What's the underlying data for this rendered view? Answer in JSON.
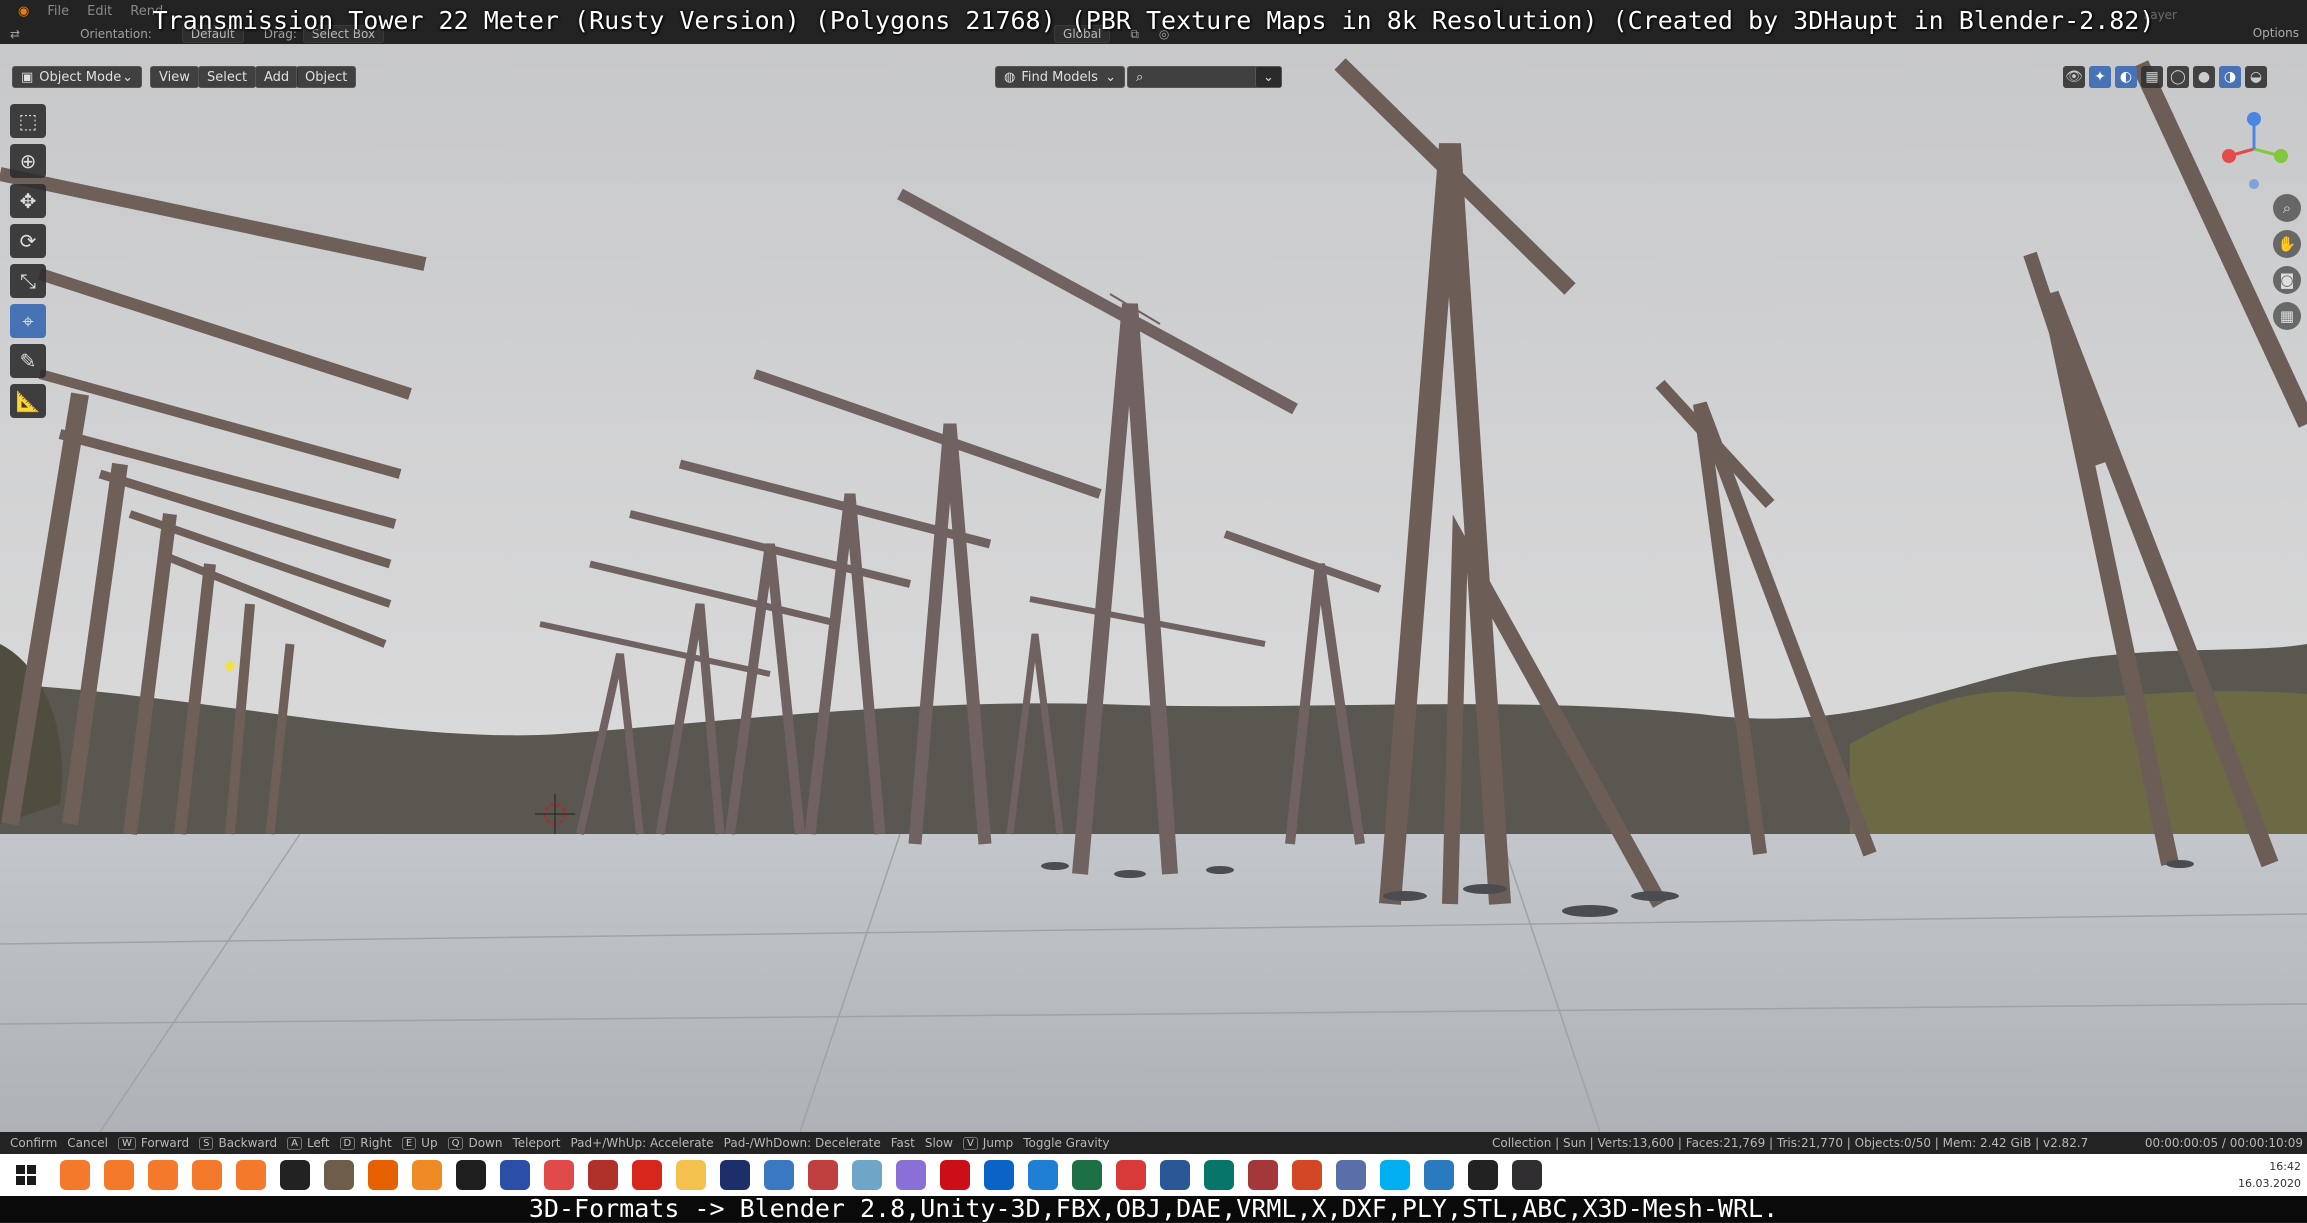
{
  "overlay": {
    "title": "Transmission Tower 22 Meter (Rusty Version) (Polygons 21768) (PBR Texture Maps in 8k Resolution) (Created by 3DHaupt in Blender-2.82)",
    "caption": "3D-Formats -> Blender 2.8,Unity-3D,FBX,OBJ,DAE,VRML,X,DXF,PLY,STL,ABC,X3D-Mesh-WRL."
  },
  "menu": {
    "items": [
      "File",
      "Edit",
      "Rend"
    ]
  },
  "header": {
    "orientation_label": "Orientation:",
    "orientation_value": "Default",
    "drag_label": "Drag:",
    "drag_value": "Select Box",
    "transform_value": "Global",
    "options_label": "Options",
    "layer_label": "Layer"
  },
  "viewport_header": {
    "mode": "Object Mode",
    "menus": [
      "View",
      "Select",
      "Add",
      "Object"
    ],
    "find_models": "Find Models"
  },
  "toolbar": {
    "tools": [
      "select-box",
      "cursor",
      "move",
      "rotate",
      "scale",
      "transform",
      "annotate",
      "measure"
    ],
    "active": "transform"
  },
  "status": {
    "shortcuts": [
      {
        "key": "",
        "label": "Confirm"
      },
      {
        "key": "",
        "label": "Cancel"
      },
      {
        "key": "W",
        "label": "Forward"
      },
      {
        "key": "S",
        "label": "Backward"
      },
      {
        "key": "A",
        "label": "Left"
      },
      {
        "key": "D",
        "label": "Right"
      },
      {
        "key": "E",
        "label": "Up"
      },
      {
        "key": "Q",
        "label": "Down"
      },
      {
        "key": "",
        "label": "Teleport"
      },
      {
        "key": "",
        "label": "Pad+/WhUp: Accelerate"
      },
      {
        "key": "",
        "label": "Pad-/WhDown: Decelerate"
      },
      {
        "key": "",
        "label": "Fast"
      },
      {
        "key": "",
        "label": "Slow"
      },
      {
        "key": "V",
        "label": "Jump"
      },
      {
        "key": "",
        "label": "Toggle Gravity"
      }
    ],
    "scene_stats": "Collection | Sun | Verts:13,600 | Faces:21,769 | Tris:21,770 | Objects:0/50 | Mem: 2.42 GiB | v2.82.7",
    "timecode": "00:00:00:05 / 00:00:10:09"
  },
  "taskbar": {
    "icons": [
      {
        "name": "blender-icon",
        "color": "#f5792a"
      },
      {
        "name": "blender-icon",
        "color": "#f5792a"
      },
      {
        "name": "blender-icon",
        "color": "#f5792a"
      },
      {
        "name": "blender-icon",
        "color": "#f5792a"
      },
      {
        "name": "blender-icon",
        "color": "#f5792a"
      },
      {
        "name": "unity-icon",
        "color": "#222222"
      },
      {
        "name": "gimp-icon",
        "color": "#6e5d4a"
      },
      {
        "name": "firefox-icon",
        "color": "#e66000"
      },
      {
        "name": "fire-icon",
        "color": "#f08a24"
      },
      {
        "name": "terminal-icon",
        "color": "#1e1e1e"
      },
      {
        "name": "save-icon",
        "color": "#2b4fa8"
      },
      {
        "name": "network-icon",
        "color": "#e04a4a"
      },
      {
        "name": "puzzle-icon",
        "color": "#b0302a"
      },
      {
        "name": "acrobat-icon",
        "color": "#d9261c"
      },
      {
        "name": "folder-icon",
        "color": "#f2c14e"
      },
      {
        "name": "x-icon",
        "color": "#1c2f6b"
      },
      {
        "name": "chart-icon",
        "color": "#3a78c2"
      },
      {
        "name": "rocket-icon",
        "color": "#c04040"
      },
      {
        "name": "cube-icon",
        "color": "#6fa6c8"
      },
      {
        "name": "balloon-icon",
        "color": "#8a6fd6"
      },
      {
        "name": "opera-icon",
        "color": "#cc0f16"
      },
      {
        "name": "outlook-icon",
        "color": "#0a64c8"
      },
      {
        "name": "edge-icon",
        "color": "#1f7fd4"
      },
      {
        "name": "excel-icon",
        "color": "#1d7044"
      },
      {
        "name": "pdf-icon",
        "color": "#d83a3a"
      },
      {
        "name": "word-icon",
        "color": "#2b5797"
      },
      {
        "name": "publisher-icon",
        "color": "#077568"
      },
      {
        "name": "access-icon",
        "color": "#a4373a"
      },
      {
        "name": "powerpoint-icon",
        "color": "#d24726"
      },
      {
        "name": "tool-icon",
        "color": "#5a6ea8"
      },
      {
        "name": "skype-icon",
        "color": "#00aff0"
      },
      {
        "name": "pen-icon",
        "color": "#2a7ac0"
      },
      {
        "name": "unity-icon",
        "color": "#222222"
      },
      {
        "name": "obs-icon",
        "color": "#302e31"
      }
    ],
    "clock_time": "16:42",
    "clock_date": "16.03.2020"
  }
}
